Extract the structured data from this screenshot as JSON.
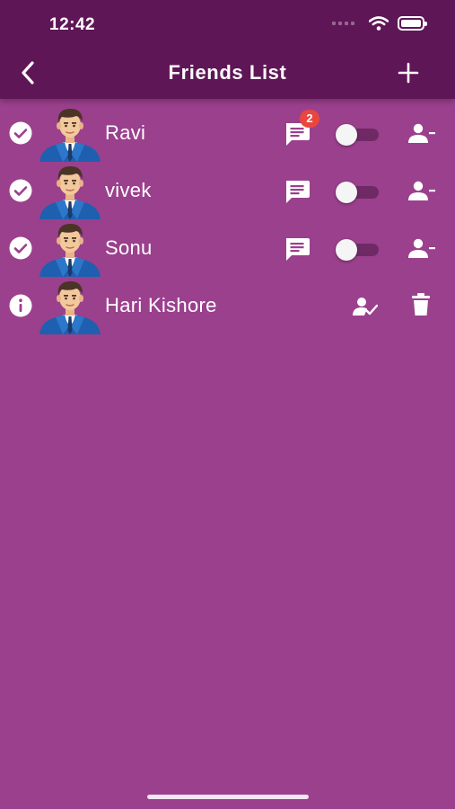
{
  "status_bar": {
    "time": "12:42"
  },
  "header": {
    "title": "Friends List"
  },
  "friends": [
    {
      "name": "Ravi",
      "unread": "2"
    },
    {
      "name": "vivek"
    },
    {
      "name": "Sonu"
    }
  ],
  "pending": [
    {
      "name": "Hari Kishore"
    }
  ],
  "colors": {
    "background": "#9b408d",
    "app_bar": "#5f1656",
    "badge": "#e9463f"
  },
  "icons": {
    "back": "chevron-left-icon",
    "add": "plus-icon",
    "friend_state": "check-circle-icon",
    "pending_state": "info-icon",
    "chat": "chat-icon",
    "remove": "remove-person-icon",
    "accept": "person-check-icon",
    "delete": "trash-icon"
  }
}
